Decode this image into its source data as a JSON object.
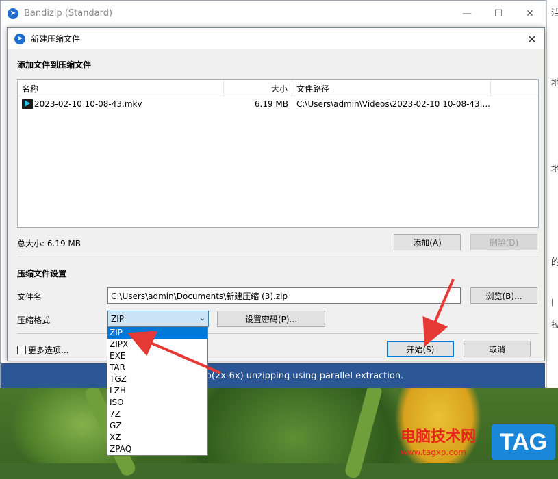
{
  "main_window": {
    "title": "Bandizip (Standard)",
    "status_text": "ed up(2x-6x) unzipping using parallel extraction."
  },
  "dialog": {
    "title": "新建压缩文件",
    "section_add": "添加文件到压缩文件",
    "columns": {
      "name": "名称",
      "size": "大小",
      "path": "文件路径"
    },
    "files": [
      {
        "name": "2023-02-10 10-08-43.mkv",
        "size": "6.19 MB",
        "path": "C:\\Users\\admin\\Videos\\2023-02-10 10-08-43...."
      }
    ],
    "total_size": "总大小: 6.19 MB",
    "add_button": "添加(A)",
    "delete_button": "删除(D)",
    "section_settings": "压缩文件设置",
    "filename_label": "文件名",
    "filename_value": "C:\\Users\\admin\\Documents\\新建压缩 (3).zip",
    "browse_button": "浏览(B)...",
    "format_label": "压缩格式",
    "format_value": "ZIP",
    "password_button": "设置密码(P)...",
    "more_options": "更多选项...",
    "start_button": "开始(S)",
    "cancel_button": "取消",
    "format_options": [
      "ZIP",
      "ZIPX",
      "EXE",
      "TAR",
      "TGZ",
      "LZH",
      "ISO",
      "7Z",
      "GZ",
      "XZ",
      "ZPAQ"
    ]
  },
  "right_panel_chars": [
    "洁",
    "地",
    "地",
    "的",
    "l",
    "拉"
  ],
  "watermark": {
    "site_name": "电脑技术网",
    "url": "www.tagxp.com",
    "tag": "TAG"
  },
  "colors": {
    "accent": "#0078d7",
    "status_strip": "#2b5797",
    "annotation": "#e53935",
    "watermark_red": "#e8251c",
    "watermark_blue": "#1a86d8"
  }
}
